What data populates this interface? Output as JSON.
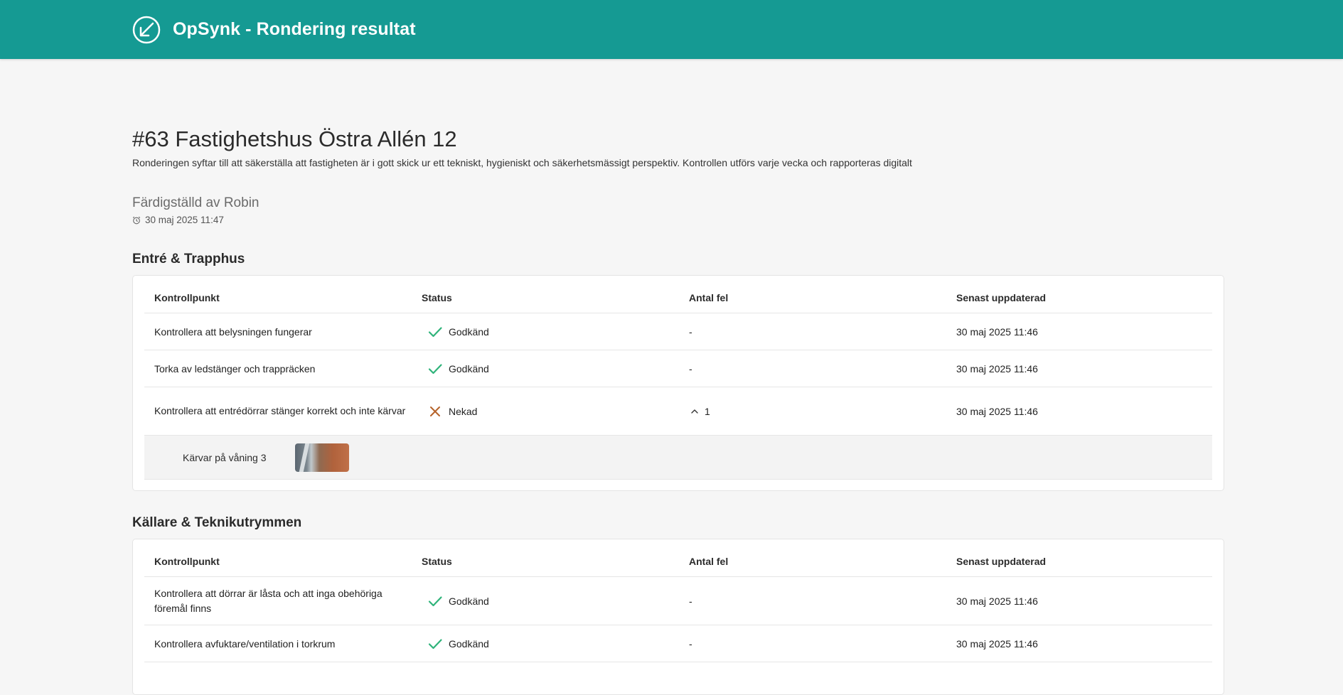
{
  "header": {
    "title": "OpSynk - Rondering resultat",
    "logo_icon": "opsynk-logo-icon"
  },
  "page": {
    "title": "#63 Fastighetshus Östra Allén 12",
    "description": "Ronderingen syftar till att säkerställa att fastigheten är i gott skick ur ett tekniskt, hygieniskt och säkerhetsmässigt perspektiv. Kontrollen utförs varje vecka och rapporteras digitalt",
    "completed_by": "Färdigställd av Robin",
    "completed_date": "30 maj 2025 11:47"
  },
  "columns": {
    "control_point": "Kontrollpunkt",
    "status": "Status",
    "error_count": "Antal fel",
    "last_updated": "Senast uppdaterad"
  },
  "colors": {
    "brand": "#159a93",
    "approved": "#2fb37a",
    "denied": "#b5622a"
  },
  "sections": [
    {
      "title": "Entré & Trapphus",
      "rows": [
        {
          "item": "Kontrollera att belysningen fungerar",
          "status": "Godkänd",
          "errors": "-",
          "updated": "30 maj 2025 11:46"
        },
        {
          "item": "Torka av ledstänger och trappräcken",
          "status": "Godkänd",
          "errors": "-",
          "updated": "30 maj 2025 11:46"
        },
        {
          "item": "Kontrollera att entrédörrar stänger korrekt och inte kärvar",
          "status": "Nekad",
          "errors": "1",
          "updated": "30 maj 2025 11:46"
        }
      ],
      "finding": {
        "text": "Kärvar på våning 3"
      }
    },
    {
      "title": "Källare & Teknikutrymmen",
      "rows": [
        {
          "item": "Kontrollera att dörrar är låsta och att inga obehöriga föremål finns",
          "status": "Godkänd",
          "errors": "-",
          "updated": "30 maj 2025 11:46"
        },
        {
          "item": "Kontrollera avfuktare/ventilation i torkrum",
          "status": "Godkänd",
          "errors": "-",
          "updated": "30 maj 2025 11:46"
        }
      ]
    }
  ]
}
